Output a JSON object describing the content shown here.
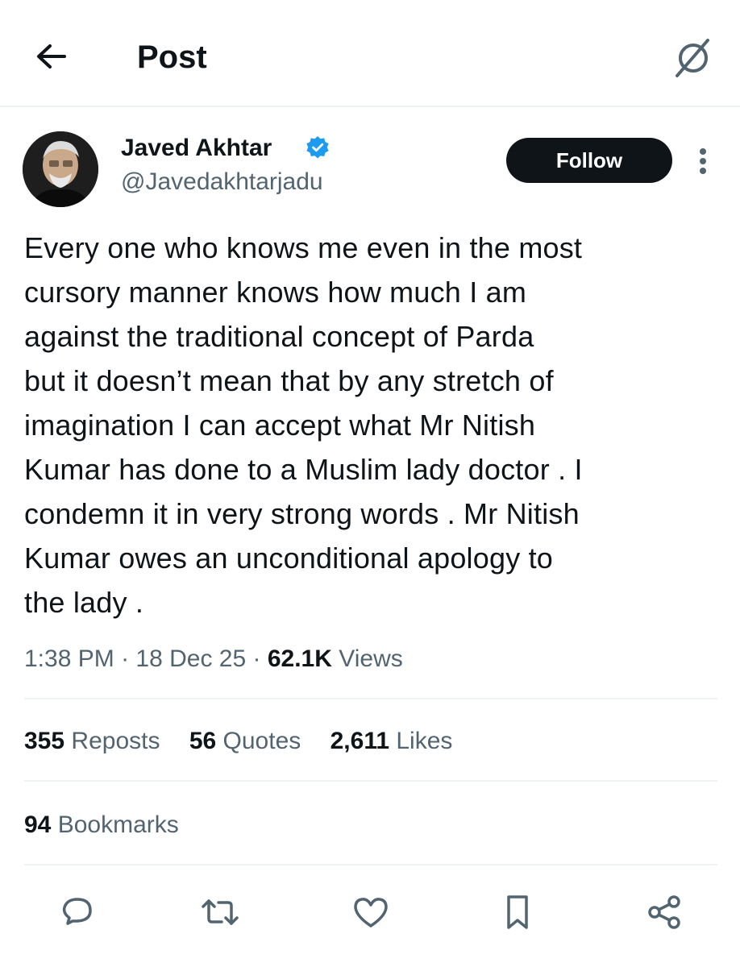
{
  "header": {
    "title": "Post",
    "back_icon": "arrow-left-icon",
    "grok_icon": "grok-icon"
  },
  "author": {
    "name": "Javed Akhtar",
    "handle": "@Javedakhtarjadu",
    "verified": true,
    "verified_color": "#1d9bf0",
    "follow_label": "Follow"
  },
  "post": {
    "text": "Every one who knows me even in the most\ncursory manner knows  how much I am\nagainst the traditional concept of Parda\nbut it doesn’t mean that by any stretch of\nimagination I can accept what Mr Nitish\nKumar has done to a Muslim lady doctor . I\ncondemn it in very strong words . Mr Nitish\nKumar owes  an unconditional apology to\nthe lady .",
    "time": "1:38 PM",
    "date": "18 Dec 25",
    "views_count": "62.1K",
    "views_label": "Views"
  },
  "stats": {
    "reposts": {
      "count": "355",
      "label": "Reposts"
    },
    "quotes": {
      "count": "56",
      "label": "Quotes"
    },
    "likes": {
      "count": "2,611",
      "label": "Likes"
    },
    "bookmarks": {
      "count": "94",
      "label": "Bookmarks"
    }
  },
  "actions": [
    "reply-icon",
    "repost-icon",
    "like-icon",
    "bookmark-icon",
    "share-icon"
  ],
  "colors": {
    "text_primary": "#0f1419",
    "text_secondary": "#536471",
    "divider": "#eff3f4",
    "follow_bg": "#0f1419"
  }
}
